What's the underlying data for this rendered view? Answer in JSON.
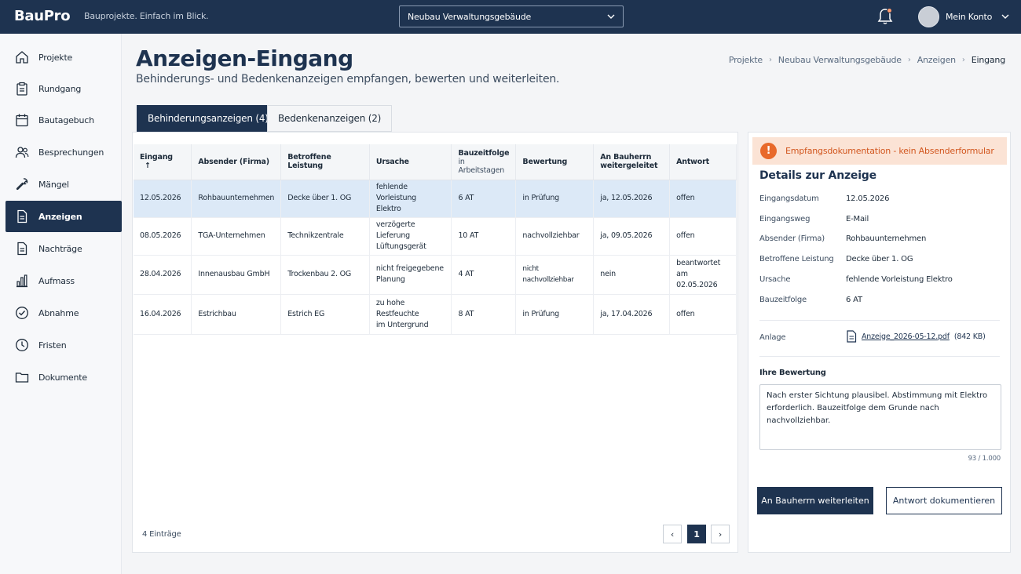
{
  "app": {
    "logo": "BauPro",
    "tagline": "Bauprojekte. Einfach im Blick.",
    "project_select": "Neubau Verwaltungsgebäude",
    "account_label": "Mein Konto",
    "notification_icon": "bell-icon",
    "accent_color": "#1e3350",
    "warning_color": "#e8692a"
  },
  "sidebar": {
    "items": [
      {
        "label": "Projekte",
        "icon": "home-icon"
      },
      {
        "label": "Rundgang",
        "icon": "clipboard-icon"
      },
      {
        "label": "Bautagebuch",
        "icon": "calendar-icon"
      },
      {
        "label": "Besprechungen",
        "icon": "people-icon"
      },
      {
        "label": "Mängel",
        "icon": "wrench-icon"
      },
      {
        "label": "Anzeigen",
        "icon": "document-icon"
      },
      {
        "label": "Nachträge",
        "icon": "document-icon"
      },
      {
        "label": "Aufmass",
        "icon": "bar-chart-icon"
      },
      {
        "label": "Abnahme",
        "icon": "check-circle-icon"
      },
      {
        "label": "Fristen",
        "icon": "clock-icon"
      },
      {
        "label": "Dokumente",
        "icon": "folder-icon"
      }
    ],
    "active_index": 5
  },
  "header": {
    "title": "Anzeigen-Eingang",
    "subtitle": "Behinderungs- und Bedenkenanzeigen empfangen, bewerten und weiterleiten.",
    "breadcrumb": [
      "Projekte",
      "Neubau Verwaltungsgebäude",
      "Anzeigen",
      "Eingang"
    ]
  },
  "tabs": [
    {
      "label": "Behinderungsanzeigen (4)",
      "active": true
    },
    {
      "label": "Bedenkenanzeigen (2)",
      "active": false
    }
  ],
  "table": {
    "columns": {
      "eingang": "Eingang",
      "absender": "Absender (Firma)",
      "leistung": "Betroffene Leistung",
      "ursache": "Ursache",
      "bauzeitfolge": "Bauzeitfolge",
      "bauzeitfolge_sub": "in Arbeitstagen",
      "bewertung": "Bewertung",
      "bauherr_1": "An Bauherrn",
      "bauherr_2": "weitergeleitet",
      "antwort": "Antwort"
    },
    "rows": [
      {
        "eingang": "12.05.2026",
        "absender": "Rohbauunternehmen",
        "leistung": "Decke über 1. OG",
        "ursache_1": "fehlende Vorleistung",
        "ursache_2": "Elektro",
        "bauzeitfolge": "6 AT",
        "bewertung": "in Prüfung",
        "bauherr": "ja, 12.05.2026",
        "antwort_1": "offen",
        "antwort_2": ""
      },
      {
        "eingang": "08.05.2026",
        "absender": "TGA-Unternehmen",
        "leistung": "Technikzentrale",
        "ursache_1": "verzögerte Lieferung",
        "ursache_2": "Lüftungsgerät",
        "bauzeitfolge": "10 AT",
        "bewertung": "nachvollziehbar",
        "bauherr": "ja, 09.05.2026",
        "antwort_1": "offen",
        "antwort_2": ""
      },
      {
        "eingang": "28.04.2026",
        "absender": "Innenausbau GmbH",
        "leistung": "Trockenbau 2. OG",
        "ursache_1": "nicht freigegebene",
        "ursache_2": "Planung",
        "bauzeitfolge": "4 AT",
        "bewertung": "nicht nachvollziehbar",
        "bauherr": "nein",
        "antwort_1": "beantwortet",
        "antwort_2": "am 02.05.2026"
      },
      {
        "eingang": "16.04.2026",
        "absender": "Estrichbau",
        "leistung": "Estrich EG",
        "ursache_1": "zu hohe Restfeuchte",
        "ursache_2": "im Untergrund",
        "bauzeitfolge": "8 AT",
        "bewertung": "in Prüfung",
        "bauherr": "ja, 17.04.2026",
        "antwort_1": "offen",
        "antwort_2": ""
      }
    ],
    "selected_row": 0,
    "entries_label": "4 Einträge",
    "current_page": "1"
  },
  "detail": {
    "alert": "Empfangsdokumentation - kein Absenderformular",
    "title": "Details zur Anzeige",
    "fields": {
      "eingangsdatum_label": "Eingangsdatum",
      "eingangsdatum": "12.05.2026",
      "eingangsweg_label": "Eingangsweg",
      "eingangsweg": "E-Mail",
      "absender_label": "Absender (Firma)",
      "absender": "Rohbauunternehmen",
      "leistung_label": "Betroffene Leistung",
      "leistung": "Decke über 1. OG",
      "ursache_label": "Ursache",
      "ursache": "fehlende Vorleistung Elektro",
      "bauzeitfolge_label": "Bauzeitfolge",
      "bauzeitfolge": "6 AT"
    },
    "anlage_label": "Anlage",
    "anlage_file": "Anzeige_2026-05-12.pdf",
    "anlage_size": "(842 KB)",
    "rating_label": "Ihre Bewertung",
    "rating_text": "Nach erster Sichtung plausibel. Abstimmung mit Elektro erforderlich. Bauzeitfolge dem Grunde nach nachvollziehbar.",
    "rating_counter": "93 / 1.000",
    "btn_forward": "An Bauherrn weiterleiten",
    "btn_document": "Antwort dokumentieren"
  }
}
